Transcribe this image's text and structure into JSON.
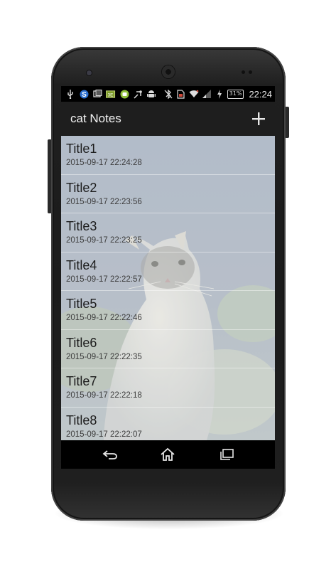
{
  "status_bar": {
    "left_icons": [
      "usb-icon",
      "s-app-icon",
      "screenshot-icon",
      "battery-saver-icon",
      "android-app-icon",
      "debug-icon",
      "android-icon"
    ],
    "right_icons": [
      "bluetooth-off-icon",
      "sim-icon",
      "wifi-icon",
      "signal-icon",
      "charging-icon"
    ],
    "battery_percent": "31%",
    "time": "22:24"
  },
  "action_bar": {
    "title": "cat Notes",
    "add_icon": "plus-icon"
  },
  "notes": [
    {
      "title": "Title1",
      "date": "2015-09-17 22:24:28"
    },
    {
      "title": "Title2",
      "date": "2015-09-17 22:23:56"
    },
    {
      "title": "Title3",
      "date": "2015-09-17 22:23:25"
    },
    {
      "title": "Title4",
      "date": "2015-09-17 22:22:57"
    },
    {
      "title": "Title5",
      "date": "2015-09-17 22:22:46"
    },
    {
      "title": "Title6",
      "date": "2015-09-17 22:22:35"
    },
    {
      "title": "Title7",
      "date": "2015-09-17 22:22:18"
    },
    {
      "title": "Title8",
      "date": "2015-09-17 22:22:07"
    }
  ],
  "nav_bar": {
    "buttons": [
      "back-icon",
      "home-icon",
      "recents-icon"
    ]
  },
  "colors": {
    "action_bar": "#1e1e1e",
    "list_overlay": "#a9b2be",
    "title_text": "#f2f2f2"
  }
}
